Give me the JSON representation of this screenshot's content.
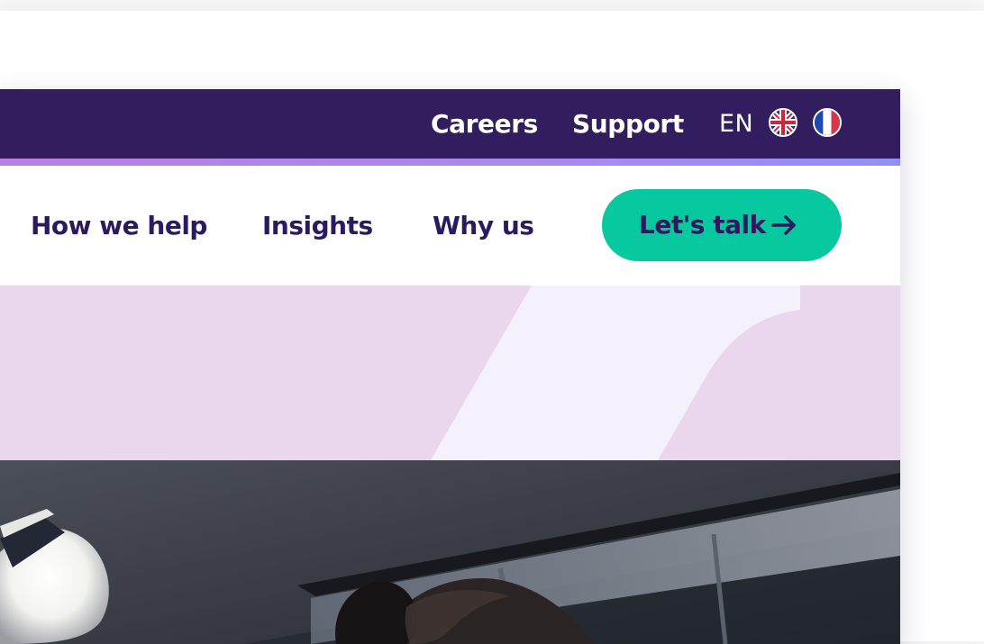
{
  "utility_nav": {
    "careers": "Careers",
    "support": "Support",
    "language": "EN"
  },
  "main_nav": {
    "items": [
      {
        "label": "How we help"
      },
      {
        "label": "Insights"
      },
      {
        "label": "Why us"
      }
    ],
    "cta_label": "Let's talk"
  },
  "colors": {
    "top_bar": "#321d5f",
    "accent_strip": "#b77fe3",
    "nav_text": "#2c1a5e",
    "cta_background": "#08c8a0",
    "hero_band": "#ead7ed",
    "hero_highlight": "#f4f1fd"
  },
  "icons": {
    "uk_flag": "united-kingdom-flag-icon",
    "fr_flag": "france-flag-icon",
    "cta_arrow": "arrow-right-icon"
  }
}
